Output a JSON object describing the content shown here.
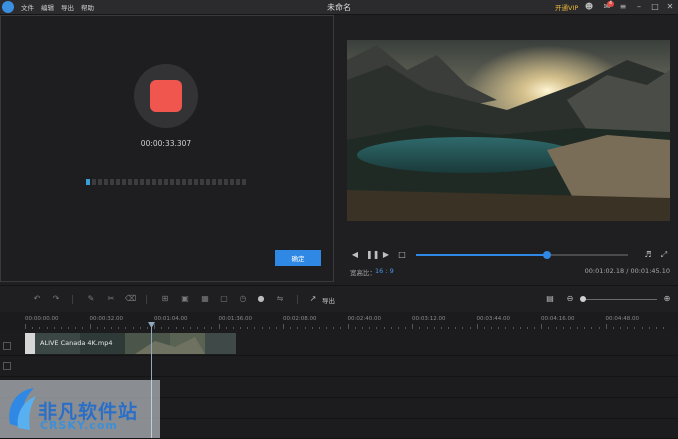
{
  "app": {
    "title": "未命名",
    "menu": [
      "文件",
      "编辑",
      "导出",
      "帮助"
    ],
    "vip_label": "开通VIP",
    "notification_count": "4"
  },
  "recorder": {
    "time": "00:00:33.307",
    "confirm_label": "确定"
  },
  "player": {
    "aspect_label": "宽高比：",
    "aspect_value": "16 : 9",
    "timecode": "00:01:02.18 / 00:01:45.10",
    "progress": 0.62
  },
  "toolbar": {
    "export_label": "导出"
  },
  "timeline": {
    "ruler": [
      "00:00:00.00",
      "00:00:32.00",
      "00:01:04.00",
      "00:01:36.00",
      "00:02:08.00",
      "00:02:40.00",
      "00:03:12.00",
      "00:03:44.00",
      "00:04:16.00",
      "00:04:48.00"
    ],
    "clip_name": "ALIVE  Canada 4K.mp4"
  },
  "watermark": {
    "text": "非凡软件站",
    "sub": "CRSKY.com"
  },
  "icons": [
    "logo-icon",
    "user-icon",
    "mail-icon",
    "minus-icon",
    "maximize-icon",
    "close-icon",
    "undo-icon",
    "redo-icon",
    "mic-icon",
    "zoom-out-icon",
    "zoom-in-icon"
  ],
  "colors": {
    "accent": "#2f88e3",
    "record": "#f0564e",
    "vip": "#e9b73b"
  }
}
